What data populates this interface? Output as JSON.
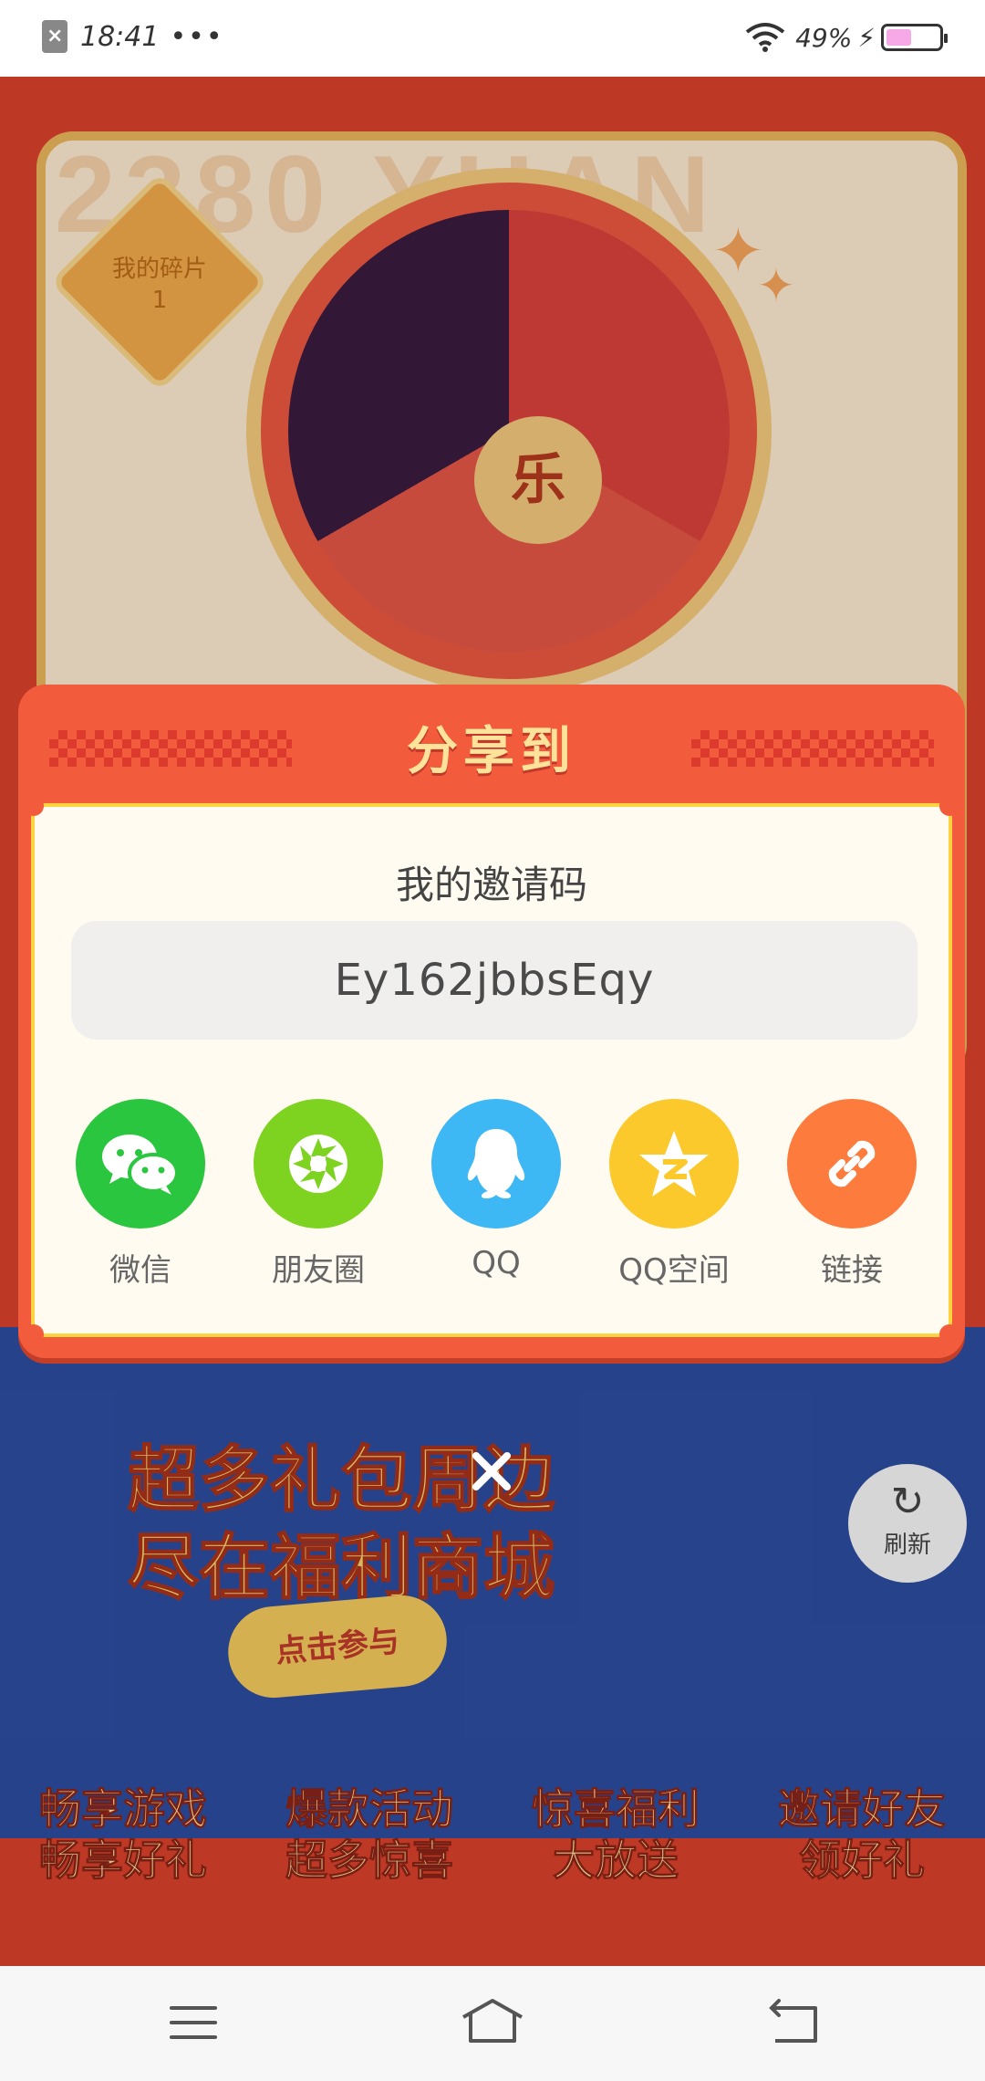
{
  "status_bar": {
    "time": "18:41",
    "dots": "•••",
    "battery_percent": "49%",
    "battery_level": 0.49,
    "battery_fill_color": "#f7a8e6",
    "icons": [
      "notification-icon",
      "wifi-icon",
      "charging-icon",
      "battery-icon"
    ]
  },
  "background": {
    "header_text": "2380 YUAN",
    "fragment_label": "我的碎片",
    "fragment_count": "1",
    "wheel_center": "乐",
    "banner_title_line1": "超多礼包周边",
    "banner_title_line2": "尽在福利商城",
    "banner_button": "点击参与",
    "features": [
      {
        "line1": "畅享游戏",
        "line2": "畅享好礼"
      },
      {
        "line1": "爆款活动",
        "line2": "超多惊喜"
      },
      {
        "line1": "惊喜福利",
        "line2": "大放送"
      },
      {
        "line1": "邀请好友",
        "line2": "领好礼"
      }
    ],
    "refresh_label": "刷新"
  },
  "share_dialog": {
    "title": "分享到",
    "invite_label": "我的邀请码",
    "invite_code": "Ey162jbbsEqy",
    "options": [
      {
        "label": "微信",
        "icon": "wechat-icon",
        "color": "#2bc63f"
      },
      {
        "label": "朋友圈",
        "icon": "moments-icon",
        "color": "#7ed321"
      },
      {
        "label": "QQ",
        "icon": "qq-icon",
        "color": "#3db8f5"
      },
      {
        "label": "QQ空间",
        "icon": "qzone-icon",
        "color": "#fbc92b"
      },
      {
        "label": "链接",
        "icon": "link-icon",
        "color": "#fd7b3d"
      }
    ],
    "accent_color": "#f25b3c"
  },
  "nav_bar": {
    "icons": [
      "menu-icon",
      "home-icon",
      "back-icon"
    ]
  }
}
